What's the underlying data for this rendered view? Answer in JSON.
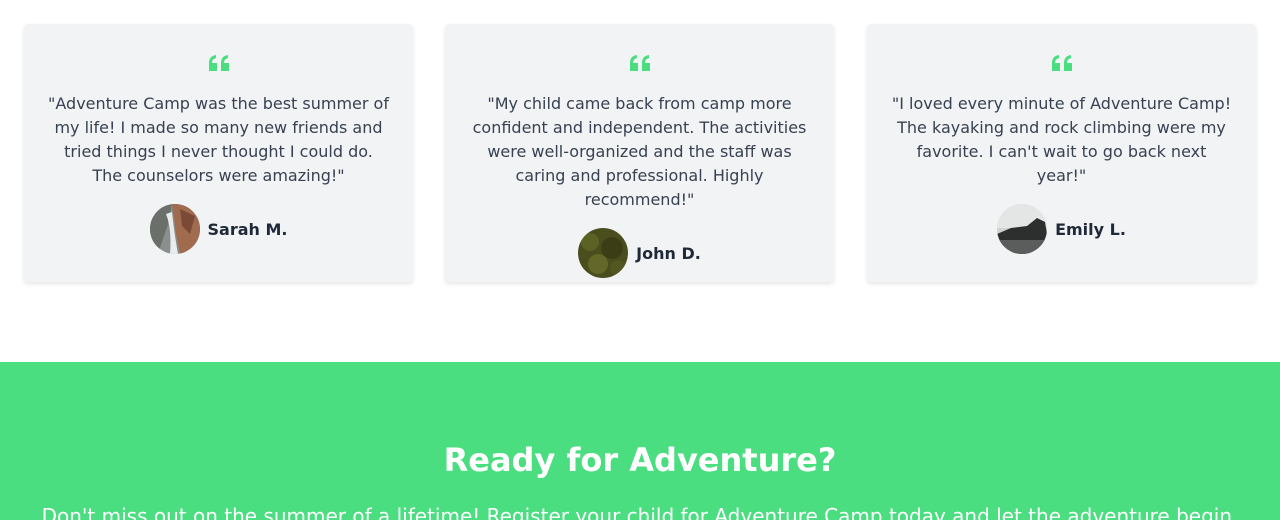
{
  "testimonials": [
    {
      "quote": "\"Adventure Camp was the best summer of my life! I made so many new friends and tried things I never thought I could do. The counselors were amazing!\"",
      "author": "Sarah M."
    },
    {
      "quote": "\"My child came back from camp more confident and independent. The activities were well-organized and the staff was caring and professional. Highly recommend!\"",
      "author": "John D."
    },
    {
      "quote": "\"I loved every minute of Adventure Camp! The kayaking and rock climbing were my favorite. I can't wait to go back next year!\"",
      "author": "Emily L."
    }
  ],
  "cta": {
    "title": "Ready for Adventure?",
    "text": "Don't miss out on the summer of a lifetime! Register your child for Adventure Camp today and let the adventure begin."
  },
  "colors": {
    "accent": "#4ade80",
    "card_bg": "#f2f3f5"
  }
}
